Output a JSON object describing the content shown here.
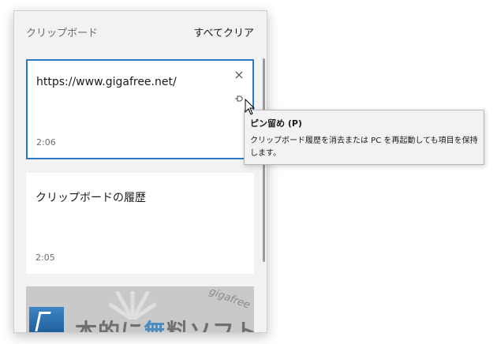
{
  "clipboard": {
    "title": "クリップボード",
    "clear_all": "すべてクリア",
    "items": [
      {
        "text": "https://www.gigafree.net/",
        "time": "2:06",
        "selected": true
      },
      {
        "text": "クリップボードの履歴",
        "time": "2:05",
        "selected": false
      }
    ],
    "image_item": {
      "text_a": "本的に",
      "text_accent": "無",
      "text_b": "料ソフト",
      "logo": "gigafree"
    }
  },
  "tooltip": {
    "title": "ピン留め (P)",
    "body": "クリップボード履歴を消去または PC を再起動しても項目を保持します。"
  },
  "icons": {
    "close": "close-icon",
    "pin": "pin-icon",
    "cursor": "mouse-cursor-icon"
  },
  "colors": {
    "selection_border": "#2b78c9",
    "panel_background": "#f2f2f2",
    "card_background": "#ffffff"
  }
}
